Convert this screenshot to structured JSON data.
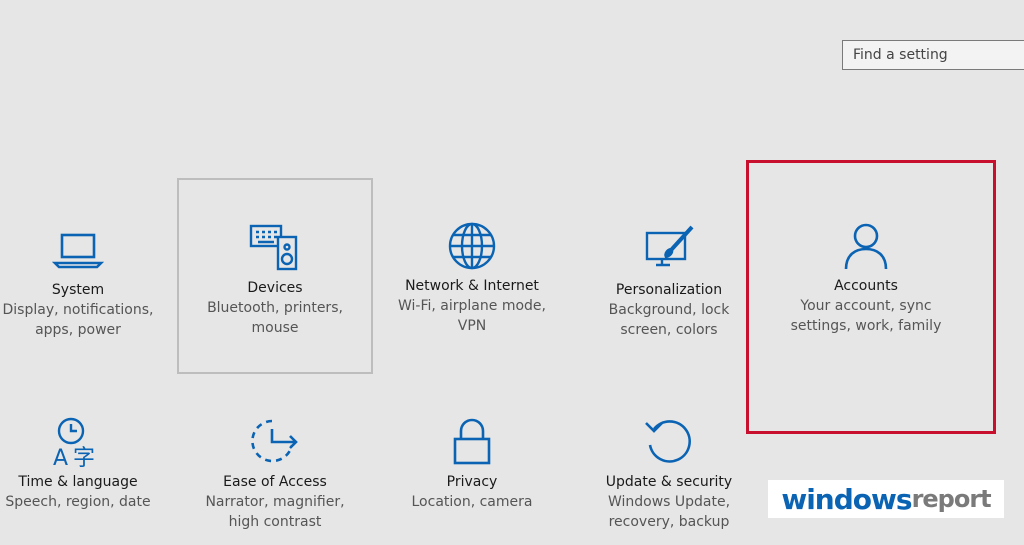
{
  "search": {
    "placeholder": "Find a setting"
  },
  "colors": {
    "icon": "#0a63b3",
    "highlight": "#c8102e",
    "tile_border": "#bdbdbd"
  },
  "tiles": [
    {
      "icon": "laptop-icon",
      "title": "System",
      "desc1": "Display, notifications,",
      "desc2": "apps, power"
    },
    {
      "icon": "devices-icon",
      "title": "Devices",
      "desc1": "Bluetooth, printers,",
      "desc2": "mouse"
    },
    {
      "icon": "globe-icon",
      "title": "Network & Internet",
      "desc1": "Wi-Fi, airplane mode,",
      "desc2": "VPN"
    },
    {
      "icon": "personalization-icon",
      "title": "Personalization",
      "desc1": "Background, lock",
      "desc2": "screen, colors"
    },
    {
      "icon": "person-icon",
      "title": "Accounts",
      "desc1": "Your account, sync",
      "desc2": "settings, work, family"
    },
    {
      "icon": "time-language-icon",
      "title": "Time & language",
      "desc1": "Speech, region, date",
      "desc2": ""
    },
    {
      "icon": "ease-of-access-icon",
      "title": "Ease of Access",
      "desc1": "Narrator, magnifier,",
      "desc2": "high contrast"
    },
    {
      "icon": "lock-icon",
      "title": "Privacy",
      "desc1": "Location, camera",
      "desc2": ""
    },
    {
      "icon": "refresh-icon",
      "title": "Update & security",
      "desc1": "Windows Update,",
      "desc2": "recovery, backup"
    }
  ],
  "watermark": {
    "part1": "windows",
    "part2": "report"
  }
}
